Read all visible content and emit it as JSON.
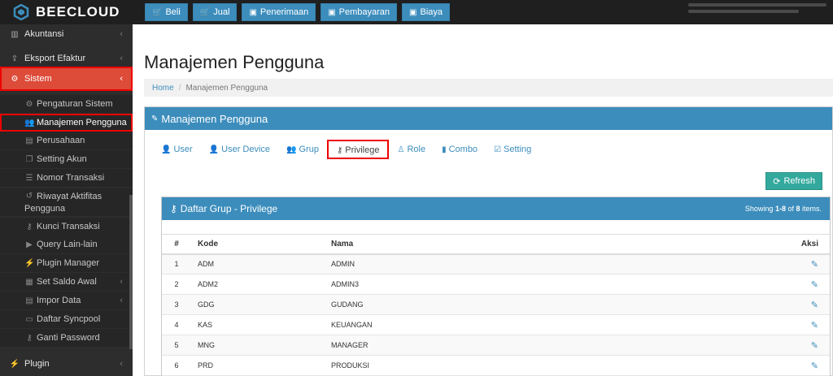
{
  "app": {
    "brand": "BEECLOUD"
  },
  "topnav": [
    {
      "label": "Beli",
      "icon": "cart-icon"
    },
    {
      "label": "Jual",
      "icon": "cart-icon"
    },
    {
      "label": "Penerimaan",
      "icon": "money-icon"
    },
    {
      "label": "Pembayaran",
      "icon": "money-icon"
    },
    {
      "label": "Biaya",
      "icon": "money-icon"
    }
  ],
  "sidebar": {
    "akuntansi": "Akuntansi",
    "ekspor": "Eksport Efaktur",
    "sistem": "Sistem",
    "sub": [
      "Pengaturan Sistem",
      "Manajemen Pengguna",
      "Perusahaan",
      "Setting Akun",
      "Nomor Transaksi",
      "Riwayat Aktifitas",
      "Pengguna",
      "Kunci Transaksi",
      "Query Lain-lain",
      "Plugin Manager",
      "Set Saldo Awal",
      "Impor Data",
      "Daftar Syncpool",
      "Ganti Password"
    ],
    "plugin": "Plugin"
  },
  "page": {
    "title": "Manajemen Pengguna",
    "breadcrumb_home": "Home",
    "breadcrumb_current": "Manajemen Pengguna",
    "panel_title": "Manajemen Pengguna"
  },
  "tabs": [
    "User",
    "User Device",
    "Grup",
    "Privilege",
    "Role",
    "Combo",
    "Setting"
  ],
  "refresh_label": "Refresh",
  "grid": {
    "title": "Daftar Grup - Privilege",
    "summary_prefix": "Showing ",
    "summary_range": "1-8",
    "summary_mid": " of ",
    "summary_total": "8",
    "summary_suffix": " items.",
    "headers": {
      "num": "#",
      "kode": "Kode",
      "nama": "Nama",
      "aksi": "Aksi"
    },
    "rows": [
      {
        "num": "1",
        "kode": "ADM",
        "nama": "ADMIN"
      },
      {
        "num": "2",
        "kode": "ADM2",
        "nama": "ADMIN3"
      },
      {
        "num": "3",
        "kode": "GDG",
        "nama": "GUDANG"
      },
      {
        "num": "4",
        "kode": "KAS",
        "nama": "KEUANGAN"
      },
      {
        "num": "5",
        "kode": "MNG",
        "nama": "MANAGER"
      },
      {
        "num": "6",
        "kode": "PRD",
        "nama": "PRODUKSI"
      }
    ]
  },
  "colors": {
    "primary": "#3c8dbc",
    "active": "#dd4b39",
    "sidebar": "#2d2d2d",
    "refresh": "#33a99d"
  }
}
